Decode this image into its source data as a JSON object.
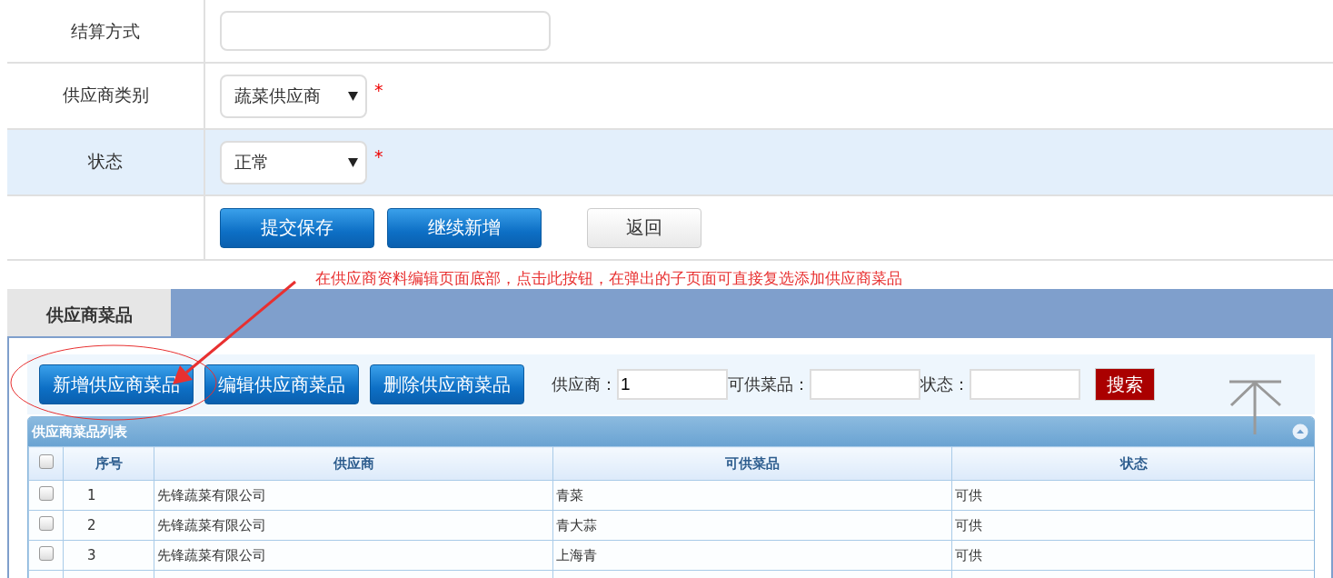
{
  "form": {
    "rows": [
      {
        "label": "结算方式",
        "kind": "text",
        "highlighted": false
      },
      {
        "label": "供应商类别",
        "kind": "select",
        "value": "蔬菜供应商",
        "required": true,
        "highlighted": false
      },
      {
        "label": "状态",
        "kind": "select",
        "value": "正常",
        "required": true,
        "highlighted": true
      },
      {
        "label": "",
        "kind": "buttons",
        "highlighted": false,
        "buttons": [
          {
            "label": "提交保存",
            "kind": "primary"
          },
          {
            "label": "继续新增",
            "kind": "primary"
          },
          {
            "label": "返回",
            "kind": "default"
          }
        ]
      }
    ],
    "required_mark": "*"
  },
  "annotation": {
    "text": "在供应商资料编辑页面底部，点击此按钮，在弹出的子页面可直接复选添加供应商菜品"
  },
  "panel": {
    "tab": "供应商菜品",
    "toolbar": {
      "buttons": [
        "新增供应商菜品",
        "编辑供应商菜品",
        "删除供应商菜品"
      ],
      "filters": [
        {
          "label": "供应商：",
          "value": "1"
        },
        {
          "label": "可供菜品："
        },
        {
          "label": "状态："
        }
      ],
      "search_button": "搜索"
    },
    "grid": {
      "title": "供应商菜品列表",
      "select_all_checked": false,
      "columns": [
        "序号",
        "供应商",
        "可供菜品",
        "状态"
      ],
      "rows": [
        {
          "checked": false,
          "cells": [
            "1",
            "先锋蔬菜有限公司",
            "青菜",
            "可供"
          ]
        },
        {
          "checked": false,
          "cells": [
            "2",
            "先锋蔬菜有限公司",
            "青大蒜",
            "可供"
          ]
        },
        {
          "checked": false,
          "cells": [
            "3",
            "先锋蔬菜有限公司",
            "上海青",
            "可供"
          ]
        }
      ]
    }
  }
}
